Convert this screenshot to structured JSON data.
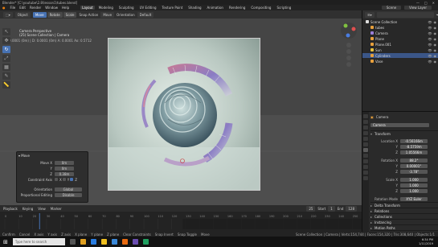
{
  "titlebar": {
    "title": "Blender* [C:\\youtube\\2.8\\lesson1\\tubes.blend]",
    "controls": [
      "—",
      "□",
      "✕"
    ]
  },
  "menubar": {
    "menus": [
      "File",
      "Edit",
      "Render",
      "Window",
      "Help"
    ],
    "workspaces": [
      "Layout",
      "Modeling",
      "Sculpting",
      "UV Editing",
      "Texture Paint",
      "Shading",
      "Animation",
      "Rendering",
      "Compositing",
      "Scripting"
    ],
    "active_workspace": "Layout",
    "scene": "Scene",
    "view_layer": "View Layer"
  },
  "vp_header": {
    "mode": "Object",
    "buttons": [
      "Move",
      "Rotate",
      "Scale"
    ],
    "active_button": "Move",
    "snap_label": "Snap Action",
    "snap_value": "Move",
    "orientation_label": "Orientation",
    "orientation_value": "Default"
  },
  "viewport": {
    "coords": "D: -0.0001 (0m) | D: 0.0001 (0m)  A: 0.0001 Ao: 0.5712",
    "info_line1": "Camera Perspective",
    "info_line2": "(25) Scene Collection | Camera",
    "tools": [
      "↖",
      "✥",
      "↻",
      "⤢",
      "▦",
      "✎",
      "📏"
    ],
    "active_tool": 2
  },
  "op_panel": {
    "title": "Move",
    "rows": [
      {
        "label": "Move X",
        "value": "0m"
      },
      {
        "label": "Y",
        "value": "0m"
      },
      {
        "label": "Z",
        "value": "0.38m"
      }
    ],
    "constraint_label": "Constraint Axis",
    "axes": [
      "X",
      "Y",
      "Z"
    ],
    "orientation_label": "Orientation",
    "orientation_value": "Global",
    "prop_edit_label": "Proportional Editing",
    "prop_edit_value": "Disable"
  },
  "timeline": {
    "items": [
      "Playback",
      "Keying",
      "View",
      "Marker"
    ],
    "frame": "25",
    "start_label": "Start",
    "start": "1",
    "end_label": "End",
    "end": "128",
    "ticks": [
      "0",
      "10",
      "20",
      "30",
      "40",
      "50",
      "60",
      "70",
      "80",
      "90",
      "100",
      "110",
      "120",
      "130",
      "140",
      "150",
      "160",
      "170",
      "180",
      "190",
      "200",
      "210",
      "220",
      "230",
      "240",
      "250"
    ],
    "current_frame": 25
  },
  "statusbar": {
    "items": [
      "Confirm",
      "Cancel",
      "X axis",
      "Y axis",
      "Z axis",
      "X plane",
      "Y plane",
      "Z plane",
      "Clear Constraints",
      "Snap Invert",
      "Snap Toggle",
      "Move",
      "Rotate",
      "Resize",
      "Automatic Constraint"
    ],
    "info": "Scene Collection | Camera | Verts:154,744 | Faces:154,320 | Tris:308,640 | Objects:1/1"
  },
  "outliner": {
    "filter_placeholder": "",
    "rows": [
      {
        "label": "Scene Collection",
        "indent": 0,
        "color": "#dddddd",
        "selected": false
      },
      {
        "label": "tubes",
        "indent": 1,
        "color": "#e8a03c",
        "selected": false
      },
      {
        "label": "Camera",
        "indent": 1,
        "color": "#9a7ed8",
        "selected": false
      },
      {
        "label": "Plane",
        "indent": 1,
        "color": "#e8a03c",
        "selected": false
      },
      {
        "label": "Plane.001",
        "indent": 1,
        "color": "#e8a03c",
        "selected": false
      },
      {
        "label": "Sun",
        "indent": 1,
        "color": "#e8c03c",
        "selected": false
      },
      {
        "label": "Cylinders",
        "indent": 1,
        "color": "#e8a03c",
        "selected": true
      },
      {
        "label": "Vase",
        "indent": 1,
        "color": "#e8a03c",
        "selected": false
      }
    ]
  },
  "properties": {
    "object_name": "Camera",
    "object_name2": "Camera",
    "transform_label": "Transform",
    "rows": [
      {
        "label": "Location X",
        "value": "-0.56166m"
      },
      {
        "label": "Y",
        "value": "-8.5759m"
      },
      {
        "label": "Z",
        "value": "1.05566m"
      },
      {
        "label": "Rotation X",
        "value": "88.2°"
      },
      {
        "label": "Y",
        "value": "0.00001°"
      },
      {
        "label": "Z",
        "value": "-3.78°"
      },
      {
        "label": "Scale X",
        "value": "1.000"
      },
      {
        "label": "Y",
        "value": "1.000"
      },
      {
        "label": "Z",
        "value": "1.000"
      },
      {
        "label": "Rotation Mode",
        "value": "XYZ Euler"
      }
    ],
    "sections": [
      "Delta Transform",
      "Relations",
      "Collections",
      "Instancing",
      "Motion Paths",
      "Viewport Display"
    ]
  },
  "taskbar": {
    "search_placeholder": "Type here to search",
    "time": "6:34 PM",
    "date": "1/11/2019"
  },
  "colors": {
    "accent": "#4772b3",
    "selection": "#3b5688",
    "playhead": "#4772b3"
  }
}
